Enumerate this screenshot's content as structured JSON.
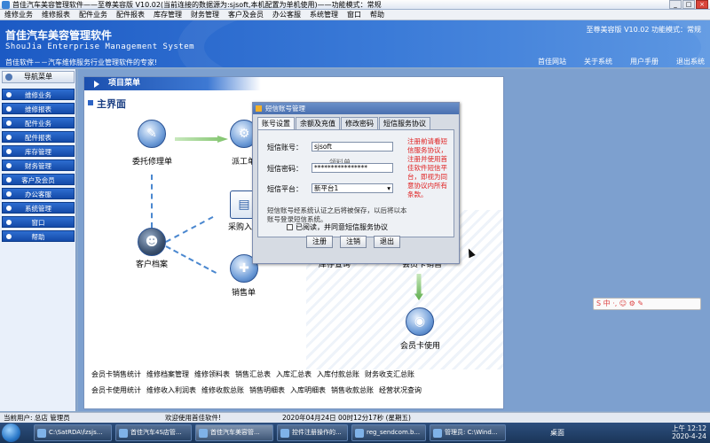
{
  "window": {
    "title": "首佳汽车美容管理软件——至尊美容版 V10.02(当前连接的数据源为:sjsoft,本机配置为单机使用)——功能模式：常规",
    "min": "_",
    "max": "□",
    "close": "×"
  },
  "menu": [
    "维修业务",
    "维修报表",
    "配件业务",
    "配件报表",
    "库存管理",
    "财务管理",
    "客户及会员",
    "办公客服",
    "系统管理",
    "窗口",
    "帮助"
  ],
  "header": {
    "title": "首佳汽车美容管理软件",
    "subtitle": "ShouJia Enterprise Management System",
    "slogan": "首佳软件－－汽车维修服务行业管理软件的专家!",
    "version": "至尊美容版  V10.02  功能模式：常规",
    "links": [
      "首佳网站",
      "关于系统",
      "用户手册",
      "退出系统"
    ]
  },
  "sidebar": {
    "header": "导航菜单",
    "items": [
      "维修业务",
      "维修报表",
      "配件业务",
      "配件报表",
      "库存管理",
      "财务管理",
      "客户及会员",
      "办公客服",
      "系统管理",
      "窗口",
      "帮助"
    ]
  },
  "panel": {
    "tab": "项目菜单",
    "main_title": "主界面",
    "nodes": {
      "repair_order": "委托修理单",
      "dispatch": "派工单",
      "purchase": "采购入库",
      "customer": "客户档案",
      "sales": "销售单",
      "stock_query": "库存查询",
      "member_sales": "会员卡销售",
      "member_use": "会员卡使用"
    },
    "links_row1": [
      "会员卡销售统计",
      "维修档案管理",
      "维修领料表",
      "销售汇总表",
      "入库汇总表",
      "入库付款总账",
      "财务收支汇总账"
    ],
    "links_row2": [
      "会员卡使用统计",
      "维修收入利润表",
      "维修收款总账",
      "销售明细表",
      "入库明细表",
      "销售收款总账",
      "经营状况查询"
    ]
  },
  "dialog": {
    "title": "短信账号管理",
    "tabs": [
      "账号设置",
      "余额及充值",
      "修改密码",
      "短信服务协议"
    ],
    "account_label": "短信账号：",
    "account_value": "sjsoft",
    "password_label": "短信密码：",
    "password_value": "****************",
    "platform_label": "短信平台：",
    "platform_value": "新平台1",
    "notice": "注册前请看短信服务协议，注册并使用首佳软件短信平台，即视为同意协议内所有条款。",
    "help_text": "短信账号经系统认证之后将被保存，以后将以本账号登录短信系统。",
    "agree": "已阅读，并同意短信服务协议",
    "register": "注册",
    "cancel": "注销",
    "exit": "退出",
    "ghost_text": "领料单"
  },
  "statusbar": {
    "user": "当前用户: 总店 管理员",
    "welcome": "欢迎使用首佳软件!",
    "datetime": "2020年04月24日 00时12分17秒 (星期五)"
  },
  "taskbar": {
    "buttons": [
      "C:\\SatRDA\\fzsjs...",
      "首佳汽车4S店管...",
      "首佳汽车美容管...",
      "控件注册操作的...",
      "reg_sendcom.b...",
      "管理员: C:\\Wind..."
    ],
    "desktop": "桌面",
    "time": "上午 12:12",
    "date": "2020-4-24"
  },
  "ime": "中 ·, ☺ ⚙ ✎"
}
